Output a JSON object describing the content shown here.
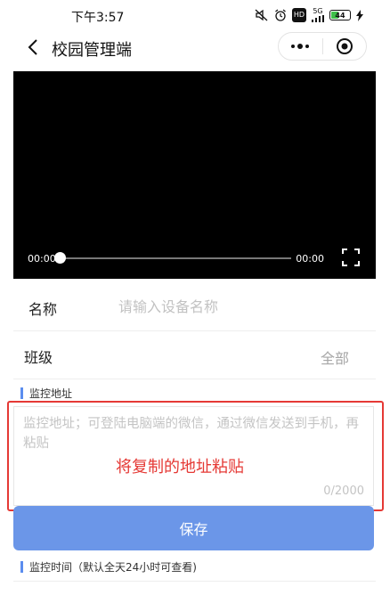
{
  "status_bar": {
    "time": "下午3:57",
    "network": "5G",
    "hd": "HD",
    "battery_level": "44",
    "battery_percent": 44,
    "battery_color": "#3fbf4a"
  },
  "nav": {
    "title": "校园管理端",
    "back_icon": "chevron-left-icon",
    "more_icon": "more-dots-icon",
    "close_icon": "target-circle-icon"
  },
  "video": {
    "current_time": "00:00",
    "duration": "00:00",
    "progress": 0
  },
  "form": {
    "name": {
      "label": "名称",
      "placeholder": "请输入设备名称",
      "value": ""
    },
    "class": {
      "label": "班级",
      "value": "全部"
    },
    "address": {
      "section_title": "监控地址",
      "placeholder": "监控地址；可登陆电脑端的微信，通过微信发送到手机，再粘贴",
      "value": "",
      "counter": "0/2000"
    },
    "annotation": "将复制的地址粘贴",
    "save_label": "保存",
    "time_section_title": "监控时间（默认全天24小时可查看)"
  },
  "colors": {
    "accent": "#6b96e8",
    "section_bar": "#5b8def",
    "annotation": "#e53935"
  }
}
